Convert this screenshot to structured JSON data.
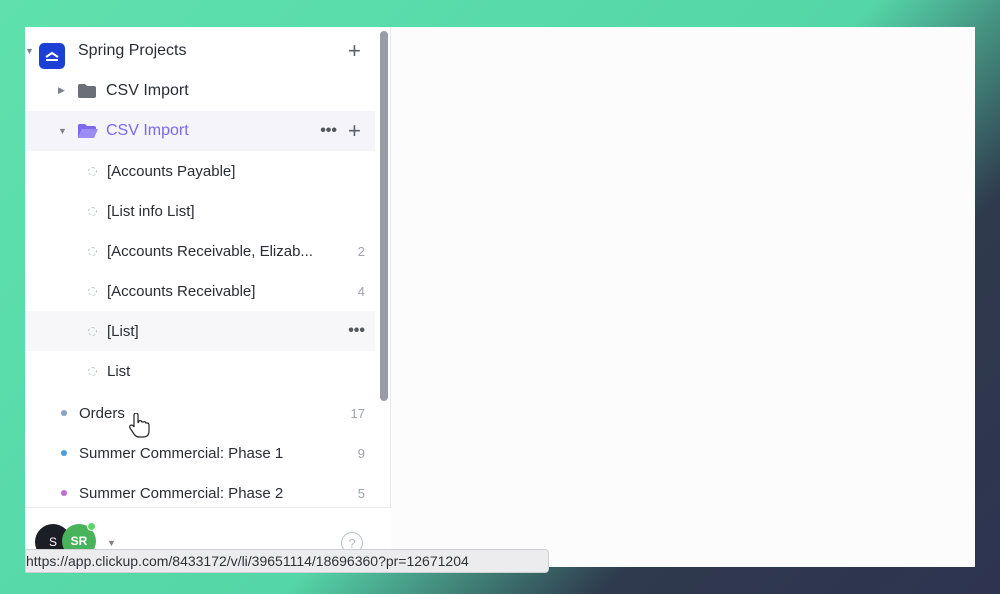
{
  "sidebar": {
    "space": {
      "name": "Spring Projects",
      "icon": "space-icon",
      "color": "#1c3fd6"
    },
    "folders": [
      {
        "name": "CSV Import",
        "expanded": false,
        "icon": "folder-icon"
      },
      {
        "name": "CSV Import",
        "expanded": true,
        "active": true,
        "icon": "folder-open-icon",
        "accent": "#7b68ee"
      }
    ],
    "lists": [
      {
        "name": "[Accounts Payable]",
        "count": ""
      },
      {
        "name": "[List info List]",
        "count": ""
      },
      {
        "name": "[Accounts Receivable, Elizab...",
        "count": "2"
      },
      {
        "name": "[Accounts Receivable]",
        "count": "4"
      },
      {
        "name": "[List]",
        "count": "",
        "hover": true
      },
      {
        "name": "List",
        "count": ""
      }
    ],
    "root_lists": [
      {
        "name": "Orders",
        "count": "17",
        "dot_color": "#8aa3c7"
      },
      {
        "name": "Summer Commercial: Phase 1",
        "count": "9",
        "dot_color": "#4a9fd8"
      },
      {
        "name": "Summer Commercial: Phase 2",
        "count": "5",
        "dot_color": "#c26ad6"
      }
    ]
  },
  "footer": {
    "avatar_s": "S",
    "avatar_sr": "SR"
  },
  "status_url": "https://app.clickup.com/8433172/v/li/39651114/18696360?pr=12671204"
}
